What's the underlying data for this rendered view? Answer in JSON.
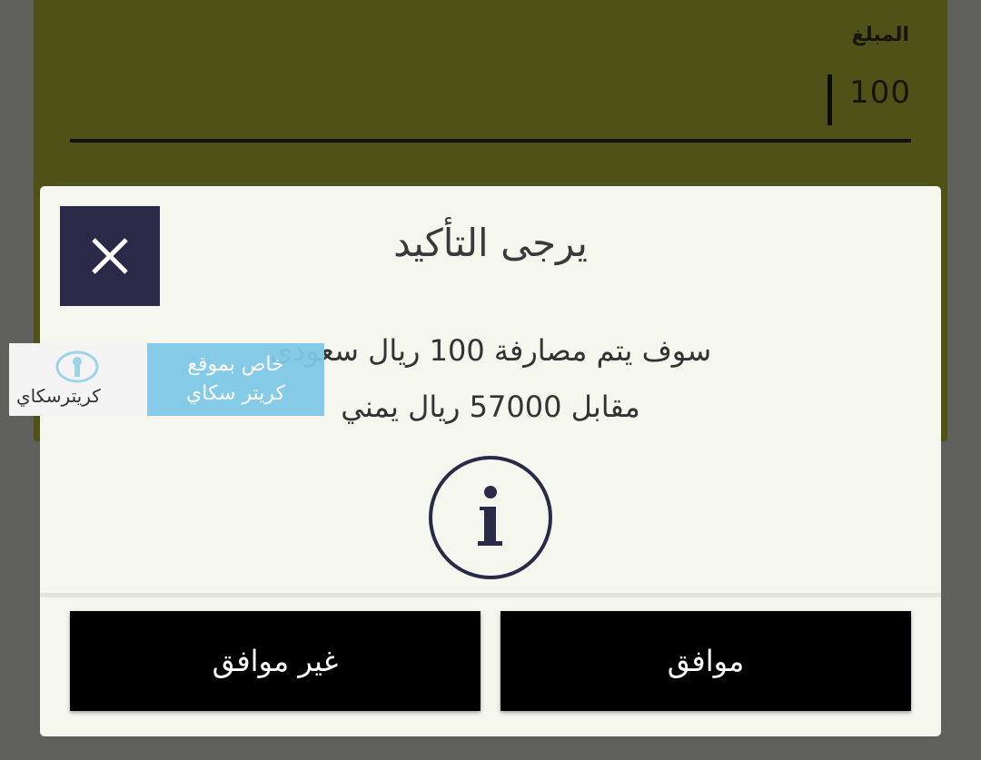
{
  "form": {
    "amount_label": "المبلغ",
    "amount_value": "100"
  },
  "dialog": {
    "title": "يرجى التأكيد",
    "message_line1": "سوف يتم  مصارفة 100 ريال سعودي",
    "message_line2": "مقابل 57000 ريال يمني",
    "icon": "info-icon",
    "close_icon": "close-icon",
    "agree_label": "موافق",
    "disagree_label": "غير موافق"
  },
  "watermark": {
    "logo_text": "كريترسكاي",
    "banner_line1": "خاص بموقع",
    "banner_line2": "كريتر سكاي"
  },
  "colors": {
    "background": "#5f5f5c",
    "form_card": "#4e5217",
    "dialog_bg": "#f5f6ee",
    "close_button": "#2a2a48",
    "action_button": "#000000",
    "watermark_banner": "#7ec8e6"
  }
}
